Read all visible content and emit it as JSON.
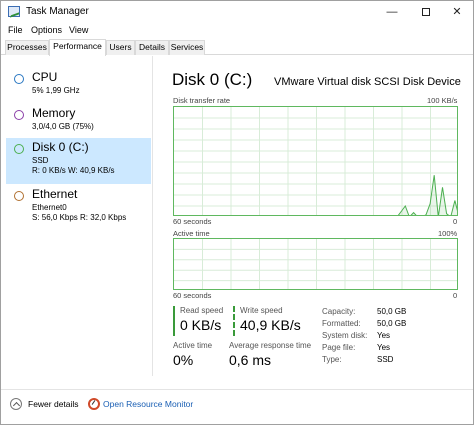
{
  "window": {
    "title": "Task Manager"
  },
  "titlebar": {
    "minimize": "—",
    "close": "✕"
  },
  "menu": {
    "file": "File",
    "options": "Options",
    "view": "View"
  },
  "tabs": {
    "processes": "Processes",
    "performance": "Performance",
    "users": "Users",
    "details": "Details",
    "services": "Services",
    "active": "performance"
  },
  "resources": {
    "cpu": {
      "name": "CPU",
      "line1": "5%  1,99 GHz",
      "ring_color": "#2a78c2"
    },
    "memory": {
      "name": "Memory",
      "line1": "3,0/4,0 GB (75%)",
      "ring_color": "#8b3fa8"
    },
    "disk": {
      "name": "Disk 0 (C:)",
      "line1": "SSD",
      "line2": "R: 0 KB/s  W: 40,9 KB/s",
      "ring_color": "#4caf50"
    },
    "ethernet": {
      "name": "Ethernet",
      "line1": "Ethernet0",
      "line2": "S: 56,0 Kbps  R: 32,0 Kbps",
      "ring_color": "#b07030"
    }
  },
  "detail": {
    "title": "Disk 0 (C:)",
    "model": "VMware Virtual disk SCSI Disk Device",
    "graph1": {
      "label": "Disk transfer rate",
      "max": "100 KB/s",
      "time": "60 seconds",
      "zero": "0"
    },
    "graph2": {
      "label": "Active time",
      "max": "100%",
      "time": "60 seconds",
      "zero": "0"
    },
    "read_speed": {
      "label": "Read speed",
      "value": "0 KB/s"
    },
    "write_speed": {
      "label": "Write speed",
      "value": "40,9 KB/s"
    },
    "active_time": {
      "label": "Active time",
      "value": "0%"
    },
    "avg_response": {
      "label": "Average response time",
      "value": "0,6 ms"
    },
    "properties": [
      {
        "key": "Capacity:",
        "value": "50,0 GB"
      },
      {
        "key": "Formatted:",
        "value": "50,0 GB"
      },
      {
        "key": "System disk:",
        "value": "Yes"
      },
      {
        "key": "Page file:",
        "value": "Yes"
      },
      {
        "key": "Type:",
        "value": "SSD"
      }
    ]
  },
  "footer": {
    "fewer_details": "Fewer details",
    "resource_monitor": "Open Resource Monitor"
  },
  "colors": {
    "graph_line": "#4caf50",
    "grid": "#d8ecd8",
    "selection": "#cce8ff",
    "link": "#1a5fb4"
  },
  "chart_data": {
    "type": "line",
    "series": [
      {
        "values": [
          0,
          0,
          0,
          0,
          0,
          0,
          0,
          0,
          0,
          0,
          0,
          0,
          0,
          0,
          0,
          0,
          0,
          0,
          0,
          0,
          0,
          0,
          0,
          0,
          0,
          0,
          0,
          0,
          0,
          0,
          0,
          0,
          0,
          0,
          0,
          0,
          0,
          0,
          0,
          0,
          0,
          0,
          0,
          0,
          0,
          0,
          0,
          0,
          0,
          0,
          0,
          0,
          0,
          0,
          0,
          5,
          10,
          0,
          4,
          0,
          0,
          2,
          12,
          38,
          0,
          27,
          3,
          0,
          15,
          0
        ]
      }
    ]
  }
}
